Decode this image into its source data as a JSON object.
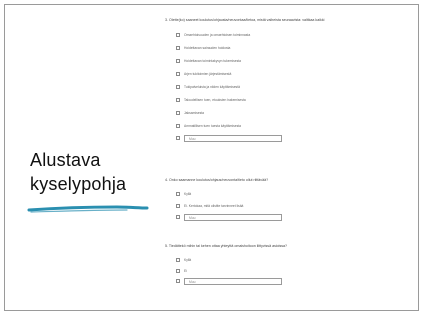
{
  "slide": {
    "title_line1": "Alustava",
    "title_line2": "kyselypohja",
    "underline_color": "#2a8fb0"
  },
  "questions": [
    {
      "title": "3. Olette(ko) saaneet koulutus/ohjausta/neuvontaa/tietoa, mistä vaiheista seuraavista: valitkaa kaikki",
      "options": [
        "Omaehtoisuuden ja omaehtoisen toiminnasta",
        "Hoidettavan sairauden hoidosta",
        "Hoidettavan toimintakyvyn tukemisesta",
        "Arjen tukitoimien järjestämisestä",
        "Tukipalveluista ja niiden käyttämisestä",
        "Taloudellisen tuen, etuuksien hakemisesta",
        "Jaksamisesta",
        "Ammatillisen tuen tuesta käyttämisesta"
      ],
      "other_label": "Muu"
    },
    {
      "title": "4. Onko saamanne koulutus/ohjaus/neuvonta/tieto ollut riittävää?",
      "options": [
        "Kyllä",
        "Ei. Kertokaa, mitä olisitte tarvinneet lisää"
      ],
      "other_label": "Muu"
    },
    {
      "title": "5. Tiedättekö mihin tai kehen ottaa yhteyttä omaishoitoon liittyvissä asioissa?",
      "options": [
        "Kyllä",
        "Ei"
      ],
      "other_label": "Muu"
    }
  ]
}
